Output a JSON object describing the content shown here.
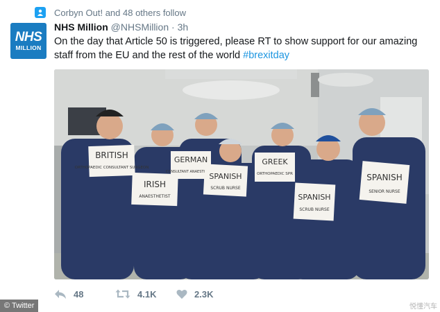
{
  "social_context": {
    "text": "Corbyn Out! and 48 others follow",
    "icon": "person-follow-icon"
  },
  "account": {
    "avatar_line1": "NHS",
    "avatar_line2": "MILLION",
    "avatar_color": "#1a7cc1",
    "name": "NHS Million",
    "handle": "@NHSMillion",
    "separator": "·",
    "time": "3h"
  },
  "tweet": {
    "text": "On the day that Article 50 is triggered, please RT to show support for our amazing staff from the EU and the rest of the world",
    "hashtag": "#brexitday",
    "hashtag_color": "#1b95e0"
  },
  "photo": {
    "signs": [
      {
        "word": "BRITISH",
        "sub": "ORTHOPAEDIC CONSULTANT SURGEON"
      },
      {
        "word": "IRISH",
        "sub": "ANAESTHETIST"
      },
      {
        "word": "GERMAN",
        "sub": "CONSULTANT ANAESTHETIST"
      },
      {
        "word": "SPANISH",
        "sub": "SCRUB NURSE"
      },
      {
        "word": "GREEK",
        "sub": "ORTHOPAEDIC SPR"
      },
      {
        "word": "SPANISH",
        "sub": "SCRUB NURSE"
      },
      {
        "word": "SPANISH",
        "sub": "SENIOR NURSE"
      }
    ]
  },
  "actions": {
    "reply_count": "48",
    "retweet_count": "4.1K",
    "like_count": "2.3K",
    "reply_icon": "reply-icon",
    "retweet_icon": "retweet-icon",
    "like_icon": "heart-icon"
  },
  "footer": {
    "badge": "© Twitter",
    "watermark": "悦懂汽车"
  }
}
